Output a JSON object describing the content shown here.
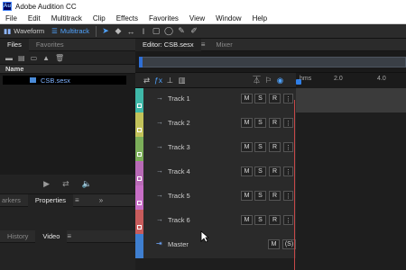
{
  "title_bar": {
    "logo": "Au",
    "title": "Adobe Audition CC"
  },
  "menu": [
    "File",
    "Edit",
    "Multitrack",
    "Clip",
    "Effects",
    "Favorites",
    "View",
    "Window",
    "Help"
  ],
  "toolbar": {
    "waveform_label": "Waveform",
    "multitrack_label": "Multitrack"
  },
  "left_panel": {
    "tabs": [
      "Files",
      "Favorites"
    ],
    "column_header": "Name",
    "file": "CSB.sesx",
    "subtabs_a": [
      "arkers",
      "Properties"
    ],
    "subtabs_b": [
      "History",
      "Video"
    ]
  },
  "editor": {
    "tabs": [
      "Editor: CSB.sesx",
      "Mixer"
    ],
    "ruler_ticks": [
      "hms",
      "2.0",
      "4.0"
    ],
    "tracks": [
      {
        "name": "Track 1",
        "color": "#3fb8a8"
      },
      {
        "name": "Track 2",
        "color": "#c2c25a"
      },
      {
        "name": "Track 3",
        "color": "#7cae5a"
      },
      {
        "name": "Track 4",
        "color": "#b86ab6"
      },
      {
        "name": "Track 5",
        "color": "#c76ec6"
      },
      {
        "name": "Track 6",
        "color": "#c85c5c"
      }
    ],
    "master": {
      "name": "Master",
      "m": "M",
      "s": "(S)"
    },
    "msr": {
      "m": "M",
      "s": "S",
      "r": "R",
      "more": "⋮"
    }
  }
}
